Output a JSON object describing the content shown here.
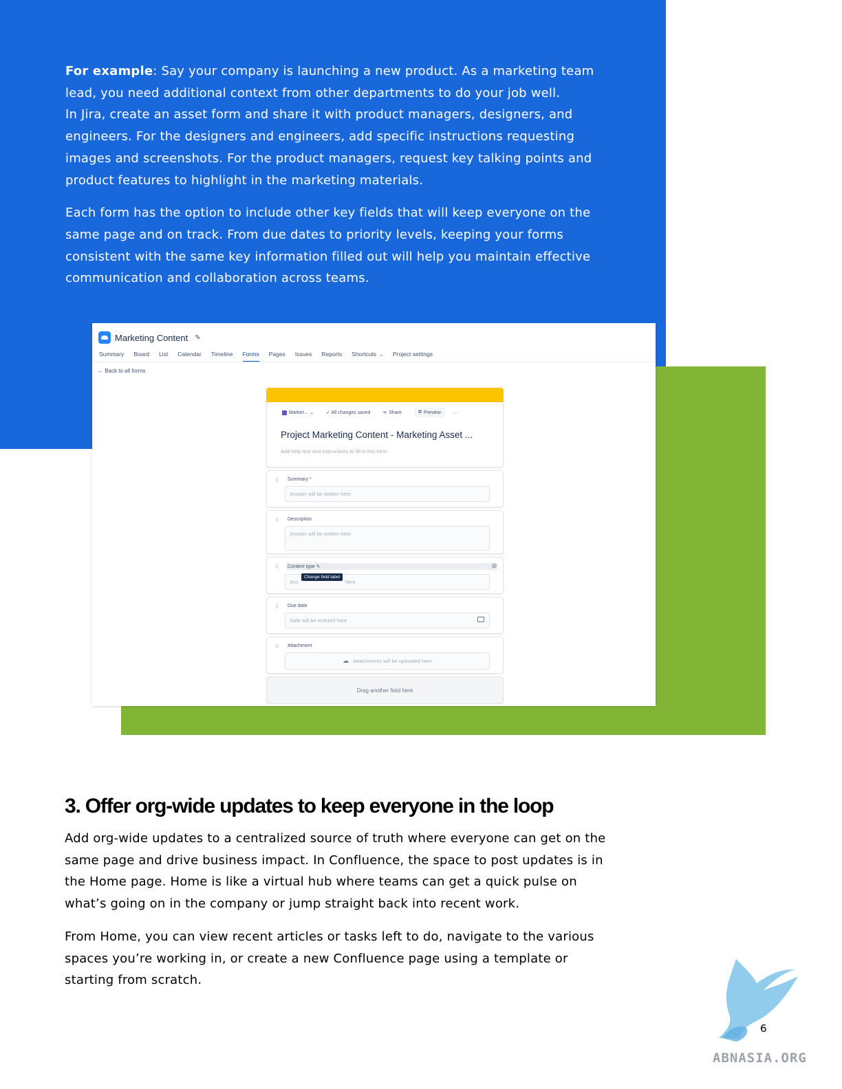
{
  "intro": {
    "example_label": "For example",
    "example_text": ": Say your company is launching a new product. As a marketing team lead, you need additional context from other departments to do your job well.",
    "example_text_2": "In Jira, create an asset form and share it with product managers, designers, and engineers. For the designers and engineers, add specific instructions requesting images and screenshots. For the product managers, request key talking points and product features to highlight in the marketing materials.",
    "paragraph_2": "Each form has the option to include other key fields that will keep everyone on the same page and on track. From due dates to priority levels, keeping your forms consistent with the same key information filled out will help you maintain effective communication and collaboration across teams."
  },
  "screenshot": {
    "project_title": "Marketing Content",
    "tabs": [
      "Summary",
      "Board",
      "List",
      "Calendar",
      "Timeline",
      "Forms",
      "Pages",
      "Issues",
      "Reports",
      "Shortcuts",
      "Project settings"
    ],
    "active_tab": "Forms",
    "back_link": "← Back to all forms",
    "form": {
      "project_chip": "Market...",
      "saved_status": "✓ All changes saved",
      "share_label": "Share",
      "preview_label": "Preview",
      "more_label": "···",
      "title": "Project Marketing Content - Marketing Asset ...",
      "help_text": "Add help text and instructions to fill in this form",
      "fields": [
        {
          "label": "Summary",
          "required_mark": "*",
          "placeholder": "Answer will be written here"
        },
        {
          "label": "Description",
          "placeholder": "Answer will be written here"
        },
        {
          "label": "Content type",
          "placeholder_start": "Ans",
          "placeholder_end": "here",
          "tooltip": "Change field label"
        },
        {
          "label": "Due date",
          "placeholder": "Date will be entered here"
        },
        {
          "label": "Attachment",
          "placeholder": "Attachments will be uploaded here"
        }
      ],
      "drag_zone": "Drag another field here"
    }
  },
  "section": {
    "heading": "3. Offer org-wide updates to keep everyone in the loop",
    "paragraph_1": "Add org-wide updates to a centralized source of truth where everyone can get on the same page and drive business impact. In Confluence, the space to post updates is in the Home page. Home is like a virtual hub where teams can get a quick pulse on what’s going on in the company or jump straight back into recent work.",
    "paragraph_2": "From Home, you can view recent articles or tasks left to do, navigate to the various spaces you’re working in, or create a new Confluence page using a template or starting from scratch."
  },
  "page_number": "6",
  "watermark_text": "ABNASIA.ORG",
  "colors": {
    "blue": "#1868db",
    "green": "#82b536",
    "form_accent": "#fbc400"
  }
}
